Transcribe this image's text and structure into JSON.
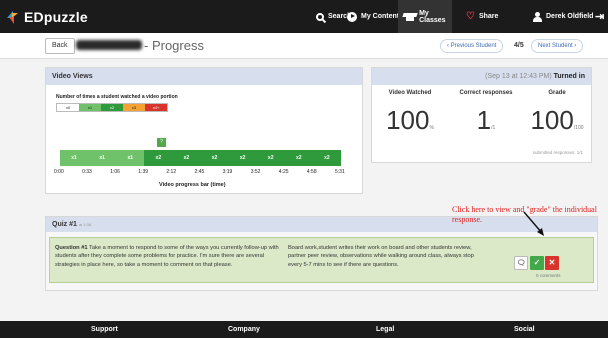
{
  "app": {
    "name": "EDpuzzle"
  },
  "nav": {
    "search": "Search",
    "my_content": "My Content",
    "my_classes": "My Classes",
    "share": "Share",
    "user": "Derek Oldfield"
  },
  "subheader": {
    "back": "Back",
    "title_suffix": "- Progress",
    "prev": "‹ Previous Student",
    "counter": "4/5",
    "next": "Next Student ›"
  },
  "video_views": {
    "title": "Video Views",
    "chart_title": "Number of times a student watched a video portion",
    "legend": [
      "x0",
      "x1",
      "x2",
      "x3",
      "x4+"
    ],
    "xlabel": "Video progress bar (time)"
  },
  "chart_data": {
    "type": "bar",
    "xlabel": "Video progress bar (time)",
    "ylabel": "",
    "ticks": [
      "0:00",
      "0:33",
      "1:06",
      "1:39",
      "2:12",
      "2:45",
      "3:19",
      "3:52",
      "4:25",
      "4:58",
      "5:31"
    ],
    "segments": [
      "x1",
      "x1",
      "x1",
      "x2",
      "x2",
      "x2",
      "x2",
      "x2",
      "x2",
      "x2"
    ],
    "segment_values": [
      1,
      1,
      1,
      2,
      2,
      2,
      2,
      2,
      2,
      2
    ],
    "question_marker": {
      "label": "?",
      "position": "1:39"
    }
  },
  "stats": {
    "timestamp": "(Sep 13 at 12:43 PM)",
    "status": "Turned in",
    "watched_label": "Video Watched",
    "watched_value": "100",
    "watched_unit": "%",
    "correct_label": "Correct responses",
    "correct_value": "1",
    "correct_unit": "/1",
    "grade_label": "Grade",
    "grade_value": "100",
    "grade_unit": "/100",
    "submitted": "submitted responses: 1/1"
  },
  "quiz": {
    "title": "Quiz #1",
    "time": "at 1:08",
    "question": "Question #1 Take a moment to respond to some of the ways you currently follow-up with students after they complete some problems for practice. I'm sure there are several strategies in place here, so take a moment to comment on that please.",
    "question_label": "Question #1",
    "question_body": "Take a moment to respond to some of the ways you currently follow-up with students after they complete some problems for practice. I'm sure there are several strategies in place here, so take a moment to comment on that please.",
    "answer": "Board work,student writes their work on board and other students review, partner peer review, observations while walking around class, always stop every 5-7 mins to see if there are questions.",
    "comments": "0 comments"
  },
  "annotation": "Click here to view and \"grade\" the individual response.",
  "footer": {
    "support": "Support",
    "company": "Company",
    "legal": "Legal",
    "social": "Social"
  },
  "colors": {
    "x1": "#6fc26a",
    "x2": "#2f9a3c",
    "x3": "#f4a236",
    "x4": "#d9342b",
    "header": "#d7dfee"
  }
}
